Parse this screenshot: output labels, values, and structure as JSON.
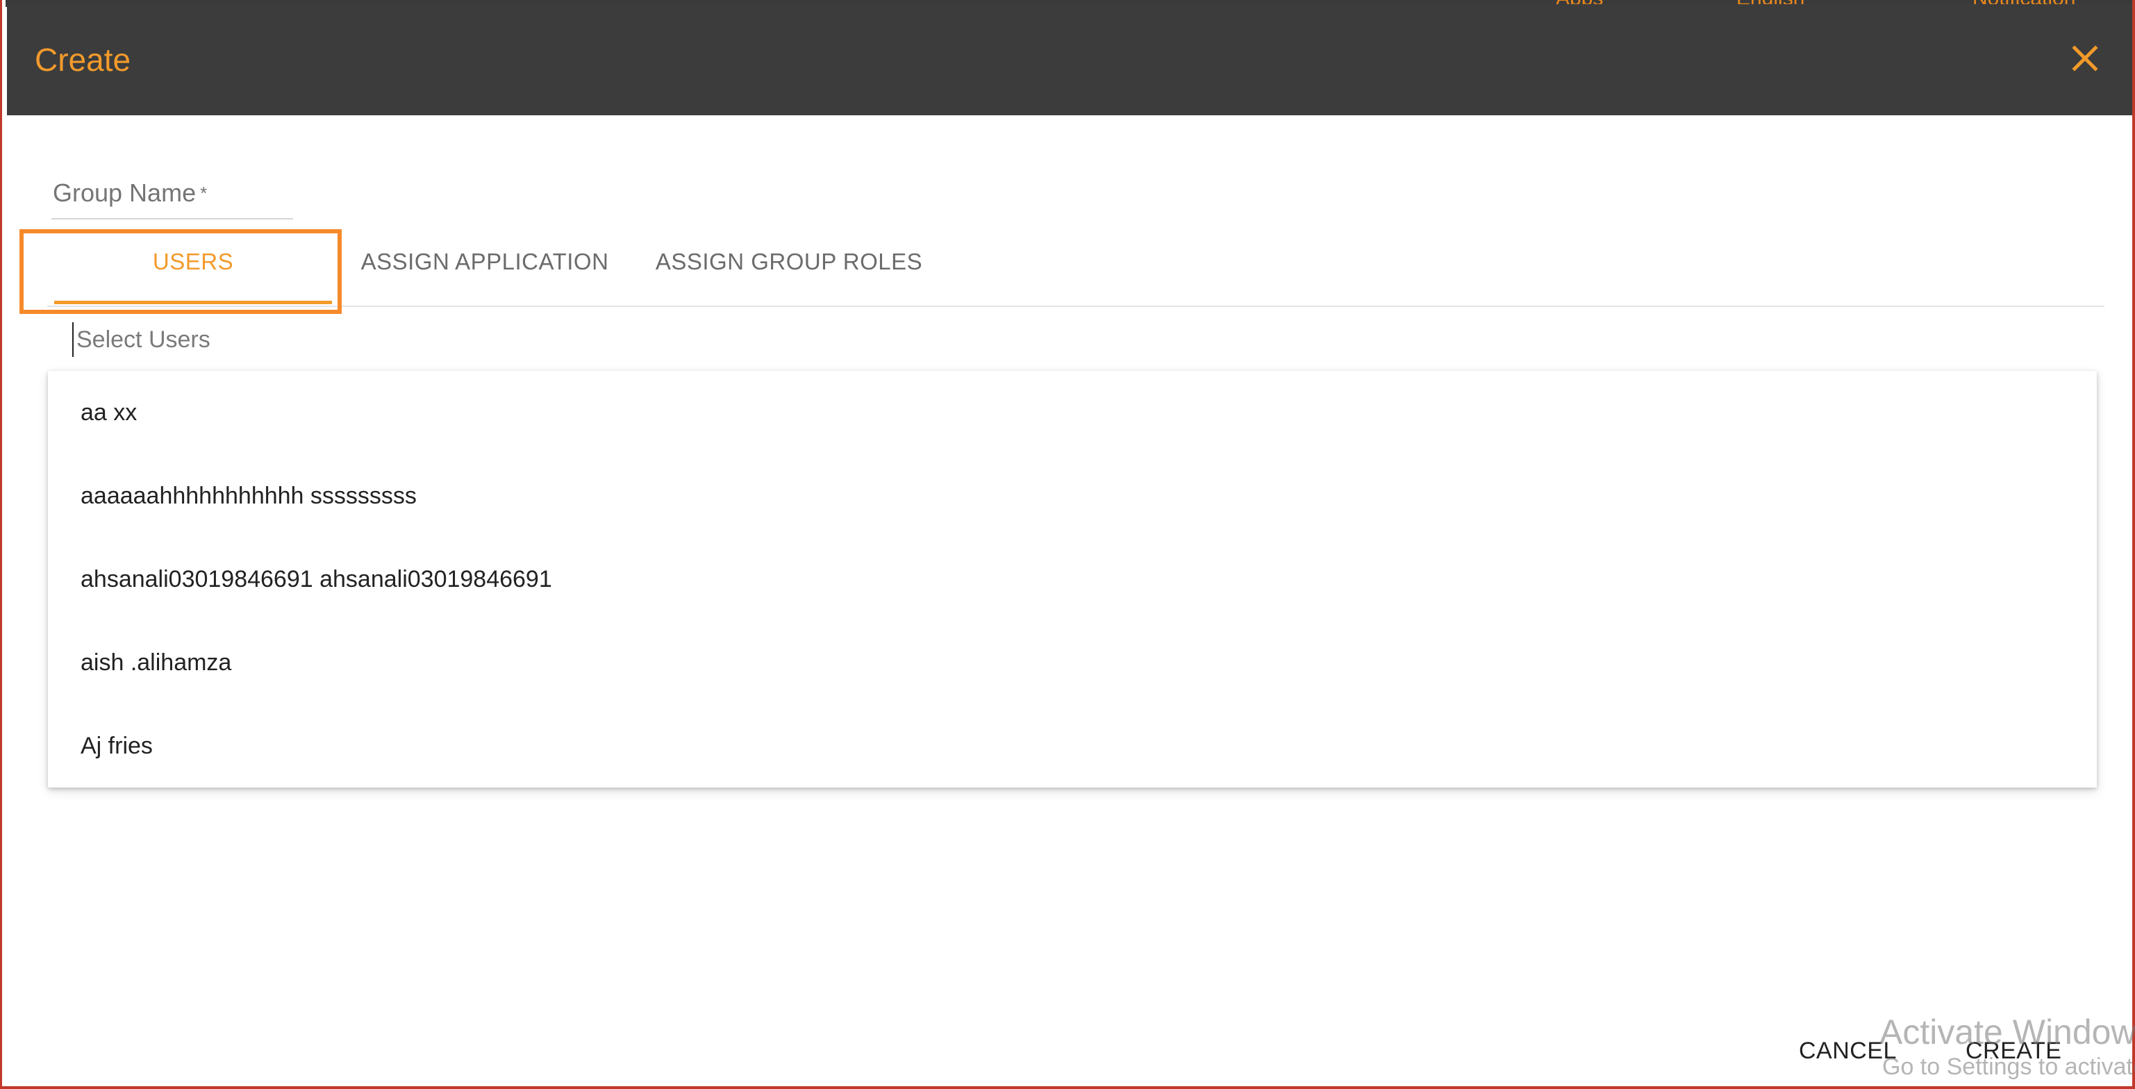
{
  "background": {
    "top_items": [
      "Apps",
      "English",
      "Notification"
    ]
  },
  "dialog": {
    "title": "Create",
    "close_icon": "close-icon",
    "group_name": {
      "label": "Group Name",
      "required_mark": "*",
      "value": ""
    },
    "tabs": [
      {
        "label": "USERS",
        "active": true
      },
      {
        "label": "ASSIGN APPLICATION",
        "active": false
      },
      {
        "label": "ASSIGN GROUP ROLES",
        "active": false
      }
    ],
    "select_users": {
      "placeholder": "Select Users",
      "value": ""
    },
    "options": [
      "aa xx",
      "aaaaaahhhhhhhhhhh sssssssss",
      "ahsanali03019846691 ahsanali03019846691",
      "aish .alihamza",
      "Aj fries"
    ],
    "buttons": {
      "cancel": "CANCEL",
      "create": "CREATE"
    }
  },
  "watermark": {
    "line1": "Activate Windows",
    "line2": "Go to Settings to activate Windows."
  },
  "colors": {
    "accent": "#f39a2b",
    "header_bg": "#3c3c3c",
    "highlight_box": "#f58a2b"
  }
}
